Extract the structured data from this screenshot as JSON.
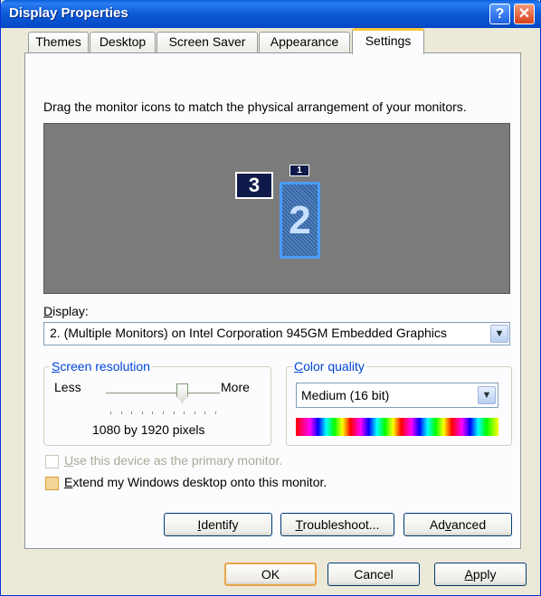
{
  "window": {
    "title": "Display Properties",
    "help_icon": "?",
    "close_icon": "✕"
  },
  "tabs": [
    "Themes",
    "Desktop",
    "Screen Saver",
    "Appearance",
    "Settings"
  ],
  "active_tab": "Settings",
  "instruction": "Drag the monitor icons to match the physical arrangement of your monitors.",
  "monitors": [
    "3",
    "1",
    "2"
  ],
  "display": {
    "label": "Display:",
    "selected": "2. (Multiple Monitors) on Intel Corporation 945GM Embedded Graphics"
  },
  "screen_resolution": {
    "title": "Screen resolution",
    "less": "Less",
    "more": "More",
    "value_text": "1080 by 1920 pixels",
    "slider_fraction": 0.69
  },
  "color_quality": {
    "title": "Color quality",
    "selected": "Medium (16 bit)"
  },
  "checkboxes": {
    "primary": {
      "label": "Use this device as the primary monitor.",
      "enabled": false,
      "checked": false
    },
    "extend": {
      "label": "Extend my Windows desktop onto this monitor.",
      "enabled": true,
      "checked": false
    }
  },
  "panel_buttons": {
    "identify": "Identify",
    "troubleshoot": "Troubleshoot...",
    "advanced": "Advanced"
  },
  "dialog_buttons": {
    "ok": "OK",
    "cancel": "Cancel",
    "apply": "Apply"
  },
  "colors": {
    "titlebar": "#0a5fdc",
    "preview_bg": "#7b7b7b",
    "active_tab_accent": "#ffc83c",
    "group_title": "#0046d5"
  }
}
